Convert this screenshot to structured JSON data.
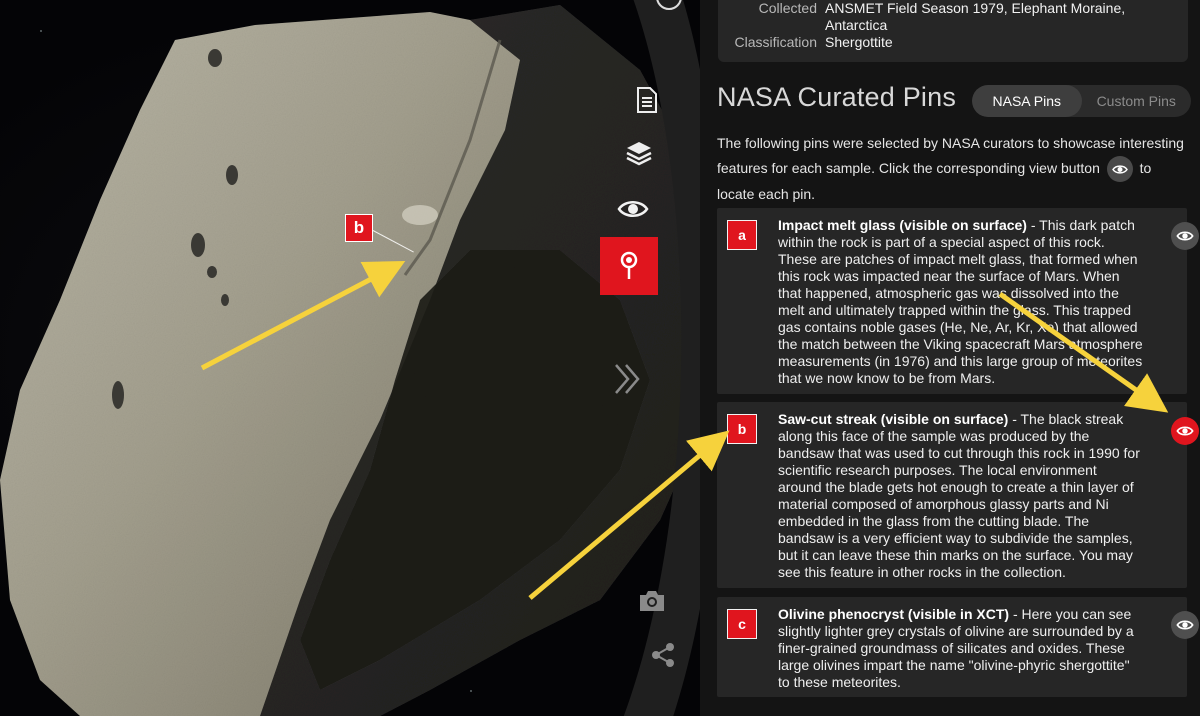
{
  "metadata": {
    "collected_label": "Collected",
    "collected_value_line1": "ANSMET Field Season 1979, Elephant Moraine,",
    "collected_value_line2": "Antarctica",
    "classification_label": "Classification",
    "classification_value": "Shergottite"
  },
  "section": {
    "title": "NASA Curated Pins",
    "toggle": {
      "active": "NASA Pins",
      "inactive": "Custom Pins"
    },
    "intro_before": "The following pins were selected by NASA curators to showcase interesting features for each sample. Click the corresponding view button",
    "intro_after": "to locate each pin."
  },
  "viewer": {
    "marker_label": "b"
  },
  "toolbar": {
    "icons": [
      "document-icon",
      "layers-icon",
      "eye-icon",
      "map-pin-icon",
      "double-chevron-right-icon",
      "camera-icon",
      "share-icon"
    ],
    "active": "map-pin-icon"
  },
  "pins": [
    {
      "badge": "a",
      "title": "Impact melt glass (visible on surface)",
      "body": " - This dark patch within the rock is part of a special aspect of this rock. These are patches of impact melt glass, that formed when this rock was impacted near the surface of Mars. When that happened, atmospheric gas was dissolved into the melt and ultimately trapped within the glass. This trapped gas contains noble gases (He, Ne, Ar, Kr, Xe) that allowed the match between the Viking spacecraft Mars atmosphere measurements (in 1976) and this large group of meteorites that we now know to be from Mars.",
      "view_active": false
    },
    {
      "badge": "b",
      "title": "Saw-cut streak (visible on surface)",
      "body": " - The black streak along this face of the sample was produced by the bandsaw that was used to cut through this rock in 1990 for scientific research purposes. The local environment around the blade gets hot enough to create a thin layer of material composed of amorphous glassy parts and Ni embedded in the glass from the cutting blade. The bandsaw is a very efficient way to subdivide the samples, but it can leave these thin marks on the surface. You may see this feature in other rocks in the collection.",
      "view_active": true
    },
    {
      "badge": "c",
      "title": "Olivine phenocryst (visible in XCT)",
      "body": " - Here you can see slightly lighter grey crystals of olivine are surrounded by a finer-grained groundmass of silicates and oxides. These large olivines impart the name \"olivine-phyric shergottite\" to these meteorites.",
      "view_active": false
    }
  ],
  "colors": {
    "accent": "#e0151e",
    "arrow": "#f6d23c",
    "panel": "#141414",
    "card": "#262626"
  }
}
